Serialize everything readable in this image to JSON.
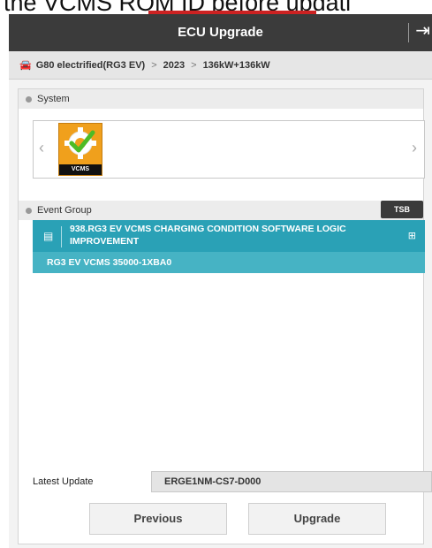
{
  "caption": "the VCMS ROM ID before updati",
  "window": {
    "title": "ECU Upgrade",
    "exit_icon": "exit-icon"
  },
  "breadcrumb": {
    "icon": "car-icon",
    "items": [
      "G80 electrified(RG3 EV)",
      "2023",
      "136kW+136kW"
    ]
  },
  "system": {
    "header": "System",
    "tiles": [
      {
        "label": "VCMS",
        "icon": "gear-check-icon",
        "color": "#f0a01c"
      }
    ]
  },
  "event_group": {
    "header": "Event Group",
    "tsb_label": "TSB",
    "items": [
      {
        "title": "938.RG3 EV VCMS CHARGING CONDITION SOFTWARE LOGIC IMPROVEMENT",
        "subtitle": "RG3 EV VCMS 35000-1XBA0"
      }
    ],
    "accent": "#46b3c4"
  },
  "latest_update": {
    "label": "Latest Update",
    "value": "ERGE1NM-CS7-D000"
  },
  "buttons": {
    "previous": "Previous",
    "upgrade": "Upgrade"
  }
}
